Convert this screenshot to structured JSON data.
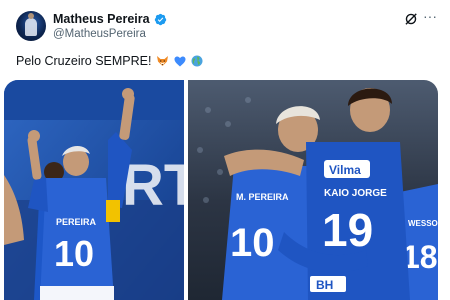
{
  "tweet": {
    "display_name": "Matheus Pereira",
    "handle": "@MatheusPereira",
    "text": "Pelo Cruzeiro SEMPRE!",
    "emojis": [
      "fox-emoji",
      "blue-heart-emoji",
      "globe-emoji"
    ],
    "verified": true
  },
  "photos": {
    "left": {
      "jersey_name": "PEREIRA",
      "jersey_number": "10",
      "background_text": "RT"
    },
    "right": {
      "player_a_name": "M. PEREIRA",
      "player_a_number": "10",
      "player_b_name": "KAIO JORGE",
      "player_b_number": "19",
      "player_c_name": "WESSON",
      "player_c_number": "18",
      "sponsor": "Vilma",
      "sponsor_2": "BH"
    }
  },
  "colors": {
    "text_primary": "#0f1419",
    "text_secondary": "#536471",
    "verified_blue": "#1d9bf0",
    "jersey_blue": "#1e4fb5"
  }
}
